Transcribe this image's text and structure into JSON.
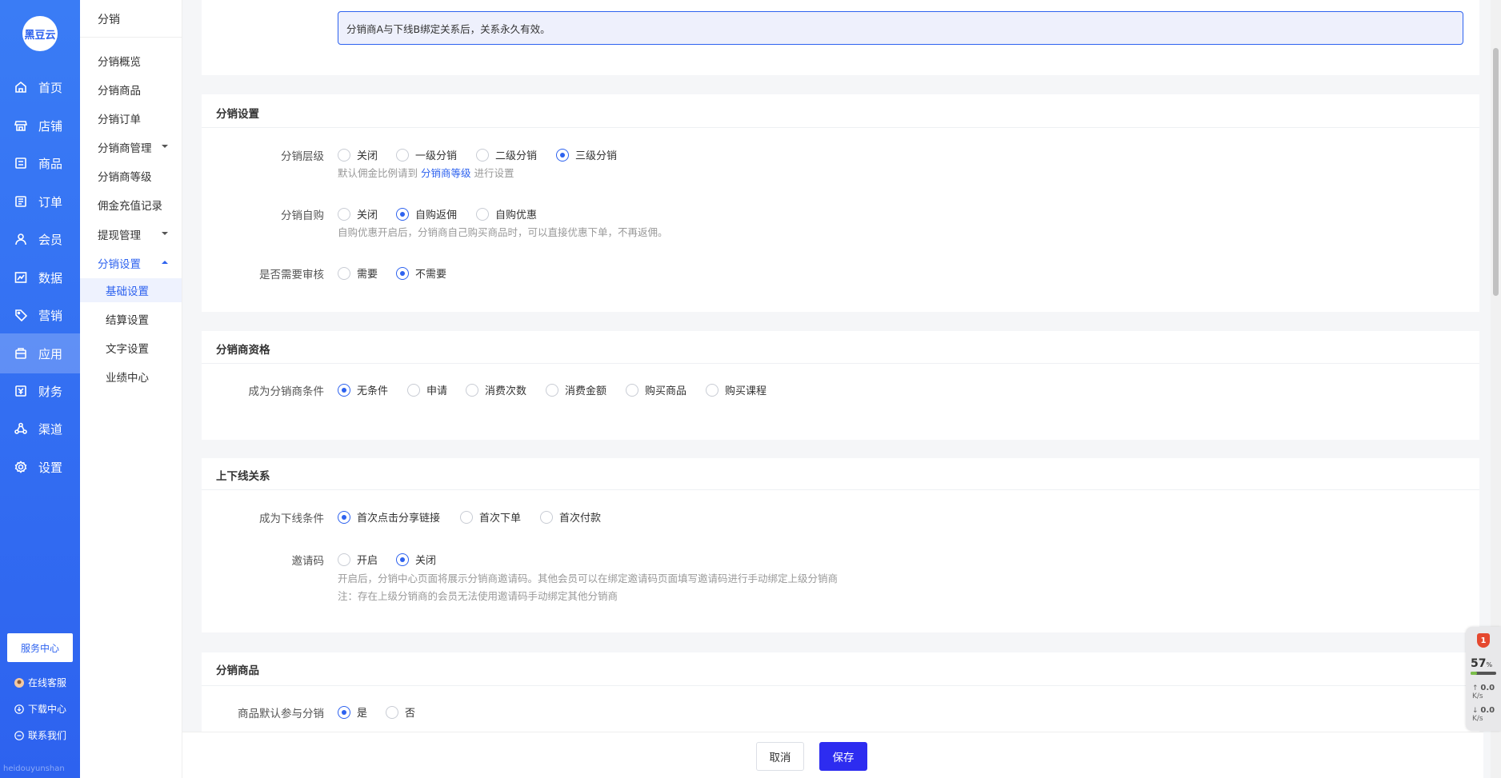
{
  "brand": {
    "logo_text": "黑豆云",
    "watermark": "heidouyunshan"
  },
  "main_nav": [
    {
      "label": "首页",
      "icon": "home-icon"
    },
    {
      "label": "店铺",
      "icon": "store-icon"
    },
    {
      "label": "商品",
      "icon": "goods-icon"
    },
    {
      "label": "订单",
      "icon": "order-icon"
    },
    {
      "label": "会员",
      "icon": "member-icon"
    },
    {
      "label": "数据",
      "icon": "chart-icon"
    },
    {
      "label": "营销",
      "icon": "tag-icon"
    },
    {
      "label": "应用",
      "icon": "app-icon",
      "active": true
    },
    {
      "label": "财务",
      "icon": "finance-icon"
    },
    {
      "label": "渠道",
      "icon": "channel-icon"
    },
    {
      "label": "设置",
      "icon": "gear-icon"
    }
  ],
  "service": {
    "button": "服务中心",
    "online": "在线客服",
    "download": "下载中心",
    "contact": "联系我们"
  },
  "sub_nav": {
    "title": "分销",
    "items": [
      "分销概览",
      "分销商品",
      "分销订单",
      "分销商管理",
      "分销商等级",
      "佣金充值记录",
      "提现管理",
      "分销设置"
    ],
    "children": [
      "基础设置",
      "结算设置",
      "文字设置",
      "业绩中心"
    ],
    "active_child": "基础设置"
  },
  "notice": "分销商A与下线B绑定关系后，关系永久有效。",
  "sections": {
    "settings": {
      "title": "分销设置",
      "level": {
        "label": "分销层级",
        "options": [
          "关闭",
          "一级分销",
          "二级分销",
          "三级分销"
        ],
        "selected": "三级分销",
        "hint_prefix": "默认佣金比例请到",
        "hint_link": "分销商等级",
        "hint_suffix": "进行设置"
      },
      "self_buy": {
        "label": "分销自购",
        "options": [
          "关闭",
          "自购返佣",
          "自购优惠"
        ],
        "selected": "自购返佣",
        "hint": "自购优惠开启后，分销商自己购买商品时，可以直接优惠下单，不再返佣。"
      },
      "review": {
        "label": "是否需要审核",
        "options": [
          "需要",
          "不需要"
        ],
        "selected": "不需要"
      }
    },
    "qualification": {
      "title": "分销商资格",
      "condition": {
        "label": "成为分销商条件",
        "options": [
          "无条件",
          "申请",
          "消费次数",
          "消费金额",
          "购买商品",
          "购买课程"
        ],
        "selected": "无条件"
      }
    },
    "relation": {
      "title": "上下线关系",
      "downline": {
        "label": "成为下线条件",
        "options": [
          "首次点击分享链接",
          "首次下单",
          "首次付款"
        ],
        "selected": "首次点击分享链接"
      },
      "invite": {
        "label": "邀请码",
        "options": [
          "开启",
          "关闭"
        ],
        "selected": "关闭",
        "hint1": "开启后，分销中心页面将展示分销商邀请码。其他会员可以在绑定邀请码页面填写邀请码进行手动绑定上级分销商",
        "hint2": "注：存在上级分销商的会员无法使用邀请码手动绑定其他分销商"
      }
    },
    "goods": {
      "title": "分销商品",
      "default_join": {
        "label": "商品默认参与分销",
        "options": [
          "是",
          "否"
        ],
        "selected": "是"
      }
    }
  },
  "footer": {
    "cancel": "取消",
    "save": "保存"
  },
  "monitor": {
    "alert_count": "1",
    "cpu_percent": 57,
    "cpu_unit": "%",
    "up_speed": "0.0",
    "down_speed": "0.0",
    "speed_unit": "K/s"
  },
  "colors": {
    "primary": "#2d62ef",
    "save_button": "#2d2cf0"
  }
}
